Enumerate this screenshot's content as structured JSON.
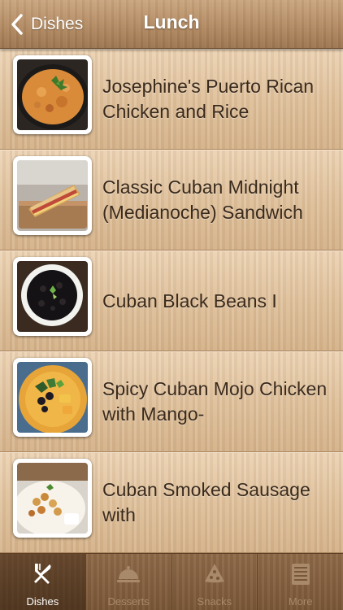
{
  "nav": {
    "back_label": "Dishes",
    "title": "Lunch"
  },
  "dishes": [
    {
      "title": "Josephine's Puerto Rican Chicken and Rice",
      "thumb_icon": "chicken-rice-photo"
    },
    {
      "title": "Classic Cuban Midnight (Medianoche) Sandwich",
      "thumb_icon": "sandwich-photo"
    },
    {
      "title": "Cuban Black Beans I",
      "thumb_icon": "black-beans-photo"
    },
    {
      "title": "Spicy Cuban Mojo Chicken with Mango-",
      "thumb_icon": "mojo-chicken-photo"
    },
    {
      "title": "Cuban Smoked Sausage with",
      "thumb_icon": "sausage-chickpeas-photo"
    }
  ],
  "tabs": [
    {
      "label": "Dishes",
      "icon": "fork-knife-icon",
      "active": true
    },
    {
      "label": "Desserts",
      "icon": "cloche-icon",
      "active": false
    },
    {
      "label": "Snacks",
      "icon": "pizza-slice-icon",
      "active": false
    },
    {
      "label": "More",
      "icon": "list-icon",
      "active": false
    }
  ],
  "colors": {
    "text_dark": "#3a2a1c",
    "tab_active": "#ffffff",
    "tab_inactive": "#a8896a"
  }
}
